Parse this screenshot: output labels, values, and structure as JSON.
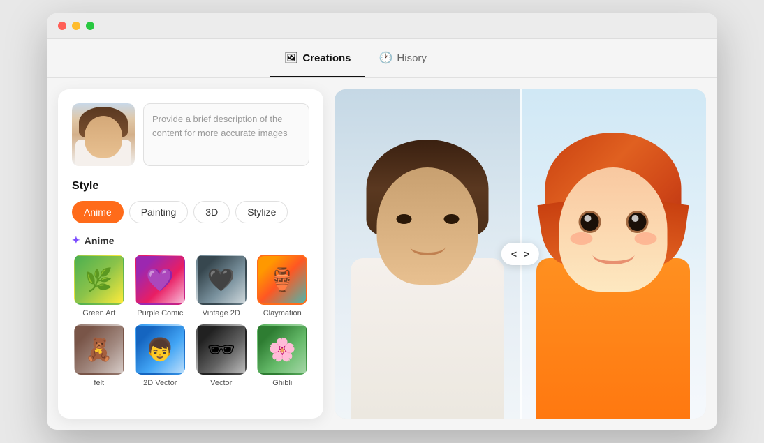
{
  "browser": {
    "traffic_lights": [
      "red",
      "yellow",
      "green"
    ]
  },
  "tabs": [
    {
      "id": "creations",
      "label": "Creations",
      "icon": "🖼",
      "active": true
    },
    {
      "id": "history",
      "label": "Hisory",
      "icon": "🕐",
      "active": false
    }
  ],
  "left_panel": {
    "description_placeholder": "Provide a brief description of the content for more accurate images",
    "style_title": "Style",
    "style_buttons": [
      {
        "id": "anime",
        "label": "Anime",
        "active": true
      },
      {
        "id": "painting",
        "label": "Painting",
        "active": false
      },
      {
        "id": "3d",
        "label": "3D",
        "active": false
      },
      {
        "id": "stylize",
        "label": "Stylize",
        "active": false
      }
    ],
    "anime_section_label": "Anime",
    "style_items": [
      {
        "id": "green-art",
        "label": "Green Art",
        "selected": false
      },
      {
        "id": "purple-comic",
        "label": "Purple Comic",
        "selected": false
      },
      {
        "id": "vintage-2d",
        "label": "Vintage 2D",
        "selected": false
      },
      {
        "id": "claymation",
        "label": "Claymation",
        "selected": true
      },
      {
        "id": "felt",
        "label": "felt",
        "selected": false
      },
      {
        "id": "2d-vector",
        "label": "2D Vector",
        "selected": false
      },
      {
        "id": "vector",
        "label": "Vector",
        "selected": false
      },
      {
        "id": "ghibli",
        "label": "Ghibli",
        "selected": false
      }
    ]
  },
  "compare_controls": {
    "left_arrow": "<",
    "right_arrow": ">"
  },
  "colors": {
    "accent_orange": "#ff6b1a",
    "active_tab_border": "#111111",
    "selected_border": "#ff6b1a",
    "anime_sparkle": "#7c4dff"
  }
}
